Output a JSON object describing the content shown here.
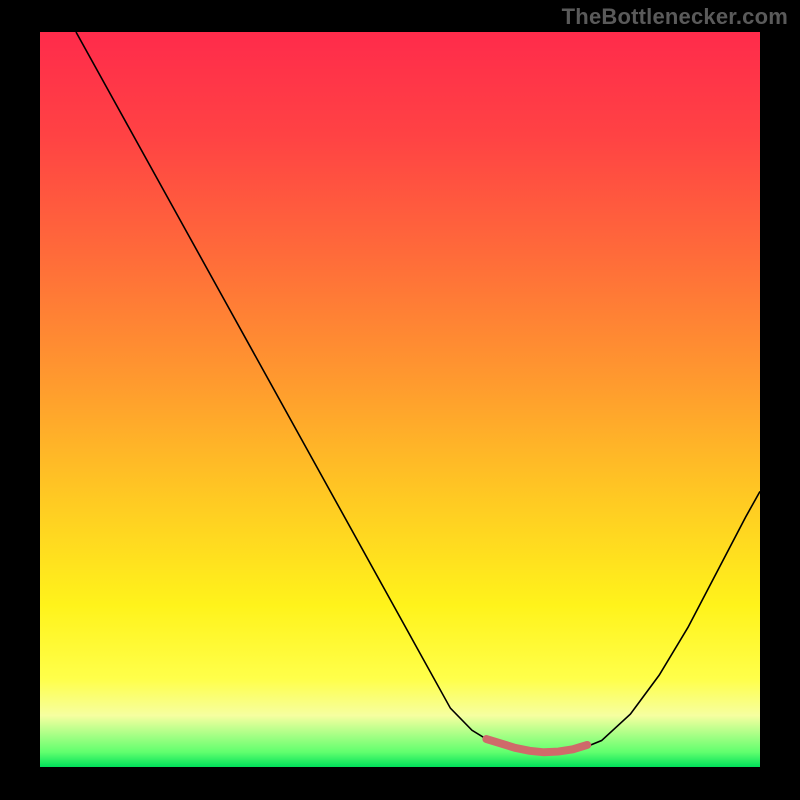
{
  "attribution": "TheBottlenecker.com",
  "chart_data": {
    "type": "line",
    "title": "",
    "xlabel": "",
    "ylabel": "",
    "xlim": [
      0,
      100
    ],
    "ylim": [
      0,
      100
    ],
    "gradient_stops": [
      {
        "offset": 0.0,
        "color": "#ff2b4b"
      },
      {
        "offset": 0.14,
        "color": "#ff4244"
      },
      {
        "offset": 0.3,
        "color": "#ff6a3a"
      },
      {
        "offset": 0.48,
        "color": "#ff9b2e"
      },
      {
        "offset": 0.63,
        "color": "#ffc823"
      },
      {
        "offset": 0.78,
        "color": "#fff31b"
      },
      {
        "offset": 0.88,
        "color": "#ffff4a"
      },
      {
        "offset": 0.93,
        "color": "#f6ffa0"
      },
      {
        "offset": 0.98,
        "color": "#60ff6e"
      },
      {
        "offset": 1.0,
        "color": "#00e05a"
      }
    ],
    "series": [
      {
        "name": "bottleneck-curve",
        "stroke": "#000000",
        "x": [
          5.0,
          10.2,
          15.4,
          20.6,
          25.8,
          31.0,
          36.2,
          41.4,
          46.6,
          51.8,
          57.0,
          60.0,
          62.5,
          65.0,
          67.5,
          70.0,
          72.5,
          75.0,
          78.0,
          82.0,
          86.0,
          90.0,
          94.0,
          98.0,
          100.0
        ],
        "y": [
          100.0,
          90.8,
          81.6,
          72.4,
          63.2,
          54.0,
          44.8,
          35.6,
          26.4,
          17.2,
          8.0,
          5.0,
          3.5,
          2.6,
          2.1,
          1.9,
          2.0,
          2.4,
          3.6,
          7.2,
          12.5,
          19.0,
          26.5,
          34.0,
          37.5
        ]
      },
      {
        "name": "optimal-band",
        "stroke": "#cf6a6a",
        "stroke_width": 8,
        "x": [
          62.0,
          64.0,
          66.0,
          68.0,
          70.0,
          72.0,
          74.0,
          76.0
        ],
        "y": [
          3.8,
          3.2,
          2.6,
          2.2,
          2.0,
          2.1,
          2.4,
          3.0
        ]
      }
    ]
  }
}
